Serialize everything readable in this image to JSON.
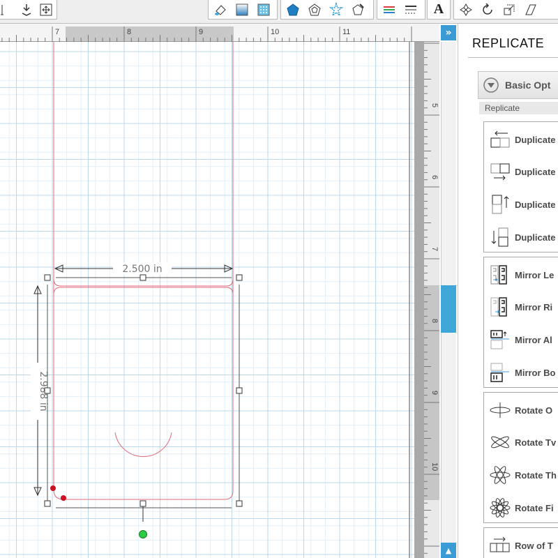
{
  "toolbar": {
    "groups": [
      {
        "name": "arrange",
        "icons": [
          "align-icon",
          "group-icon",
          "weld-icon"
        ]
      },
      {
        "name": "fill",
        "icons": [
          "fill-bucket-icon",
          "gradient-icon",
          "pattern-icon"
        ]
      },
      {
        "name": "shapes",
        "icons": [
          "pentagon-filled-icon",
          "pentagon-outline-icon",
          "star-outline-icon",
          "pentagon-pen-icon"
        ]
      },
      {
        "name": "lines",
        "icons": [
          "line-color-icon",
          "line-style-icon"
        ]
      },
      {
        "name": "text",
        "icons": [
          "text-icon"
        ]
      },
      {
        "name": "transform",
        "icons": [
          "replicate-icon",
          "rotate-icon",
          "scale-icon",
          "shear-icon"
        ]
      }
    ],
    "text_label": "A"
  },
  "ruler": {
    "horizontal_ticks": [
      "7",
      "8",
      "9",
      "10",
      "11"
    ],
    "vertical_ticks": [
      "5",
      "6",
      "7",
      "8",
      "9",
      "10"
    ]
  },
  "dimensions": {
    "width_label": "2.500 in",
    "height_label": "2.988 in"
  },
  "panel": {
    "title": "REPLICATE",
    "basic_options": "Basic Opt",
    "section": "Replicate",
    "groups": [
      {
        "items": [
          "Duplicate",
          "Duplicate",
          "Duplicate",
          "Duplicate"
        ]
      },
      {
        "items": [
          "Mirror Le",
          "Mirror Ri",
          "Mirror Al",
          "Mirror Bo"
        ]
      },
      {
        "items": [
          "Rotate O",
          "Rotate Tv",
          "Rotate Th",
          "Rotate Fi"
        ]
      },
      {
        "items": [
          "Row of T"
        ]
      }
    ]
  },
  "colors": {
    "shape_line": "#e06a78",
    "grid_major": "#bcd8ec",
    "grid_minor": "#e3eff8",
    "accent": "#3a9bd5",
    "rotate_handle": "#2ecc40",
    "point_marker": "#cc1122"
  }
}
